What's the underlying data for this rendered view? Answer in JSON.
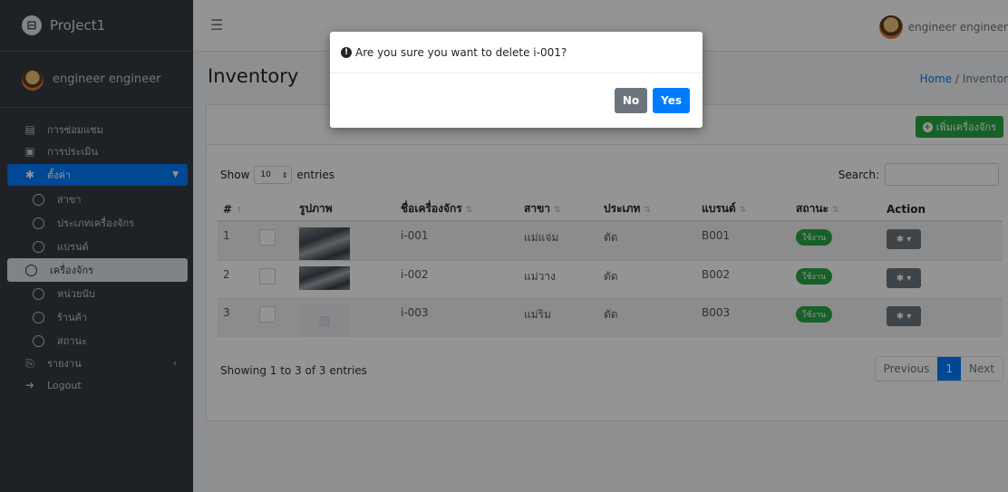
{
  "brand": {
    "title": "ProJect1",
    "logo_icon": "project-logo-icon"
  },
  "user": {
    "name": "engineer engineer"
  },
  "sidebar": {
    "items": [
      {
        "label": "การซ่อมแซม",
        "icon": "clipboard-icon"
      },
      {
        "label": "การประเมิน",
        "icon": "clipboard-check-icon"
      },
      {
        "label": "ตั้งค่า",
        "icon": "gear-icon"
      },
      {
        "label": "รายงาน",
        "icon": "pdf-icon"
      },
      {
        "label": "Logout",
        "icon": "logout-icon"
      }
    ],
    "sub_items": [
      {
        "label": "สาขา"
      },
      {
        "label": "ประเภทเครื่องจักร"
      },
      {
        "label": "แบรนด์"
      },
      {
        "label": "เครื่องจักร"
      },
      {
        "label": "หน่วยนับ"
      },
      {
        "label": "ร้านค้า"
      },
      {
        "label": "สถานะ"
      }
    ]
  },
  "header": {
    "top_user": "engineer engineer"
  },
  "page": {
    "title": "Inventory",
    "breadcrumb_home": "Home",
    "breadcrumb_sep": "/",
    "breadcrumb_current": "Inventor"
  },
  "card": {
    "add_label": "เพิ่มเครื่องจักร"
  },
  "table_controls": {
    "show_label": "Show",
    "page_length": "10",
    "entries_label": "entries",
    "search_label": "Search:"
  },
  "table": {
    "headers": [
      "#",
      "",
      "รูปภาพ",
      "ชื่อเครื่องจักร",
      "สาขา",
      "ประเภท",
      "แบรนด์",
      "สถานะ",
      "Action"
    ],
    "rows": [
      {
        "num": "1",
        "name": "i-001",
        "branch": "แม่แจ่ม",
        "type": "ตัด",
        "brand": "B001",
        "status": "ใช้งาน"
      },
      {
        "num": "2",
        "name": "i-002",
        "branch": "แม่วาง",
        "type": "ตัด",
        "brand": "B002",
        "status": "ใช้งาน"
      },
      {
        "num": "3",
        "name": "i-003",
        "branch": "แม่ริม",
        "type": "ตัด",
        "brand": "B003",
        "status": "ใช้งาน"
      }
    ]
  },
  "footer": {
    "info": "Showing 1 to 3 of 3 entries",
    "prev": "Previous",
    "page": "1",
    "next": "Next"
  },
  "modal": {
    "message": "Are you sure you want to delete i-001?",
    "no_label": "No",
    "yes_label": "Yes"
  },
  "colors": {
    "primary": "#007bff",
    "success": "#28a745",
    "secondary": "#6c757d",
    "sidebar": "#343a40"
  }
}
